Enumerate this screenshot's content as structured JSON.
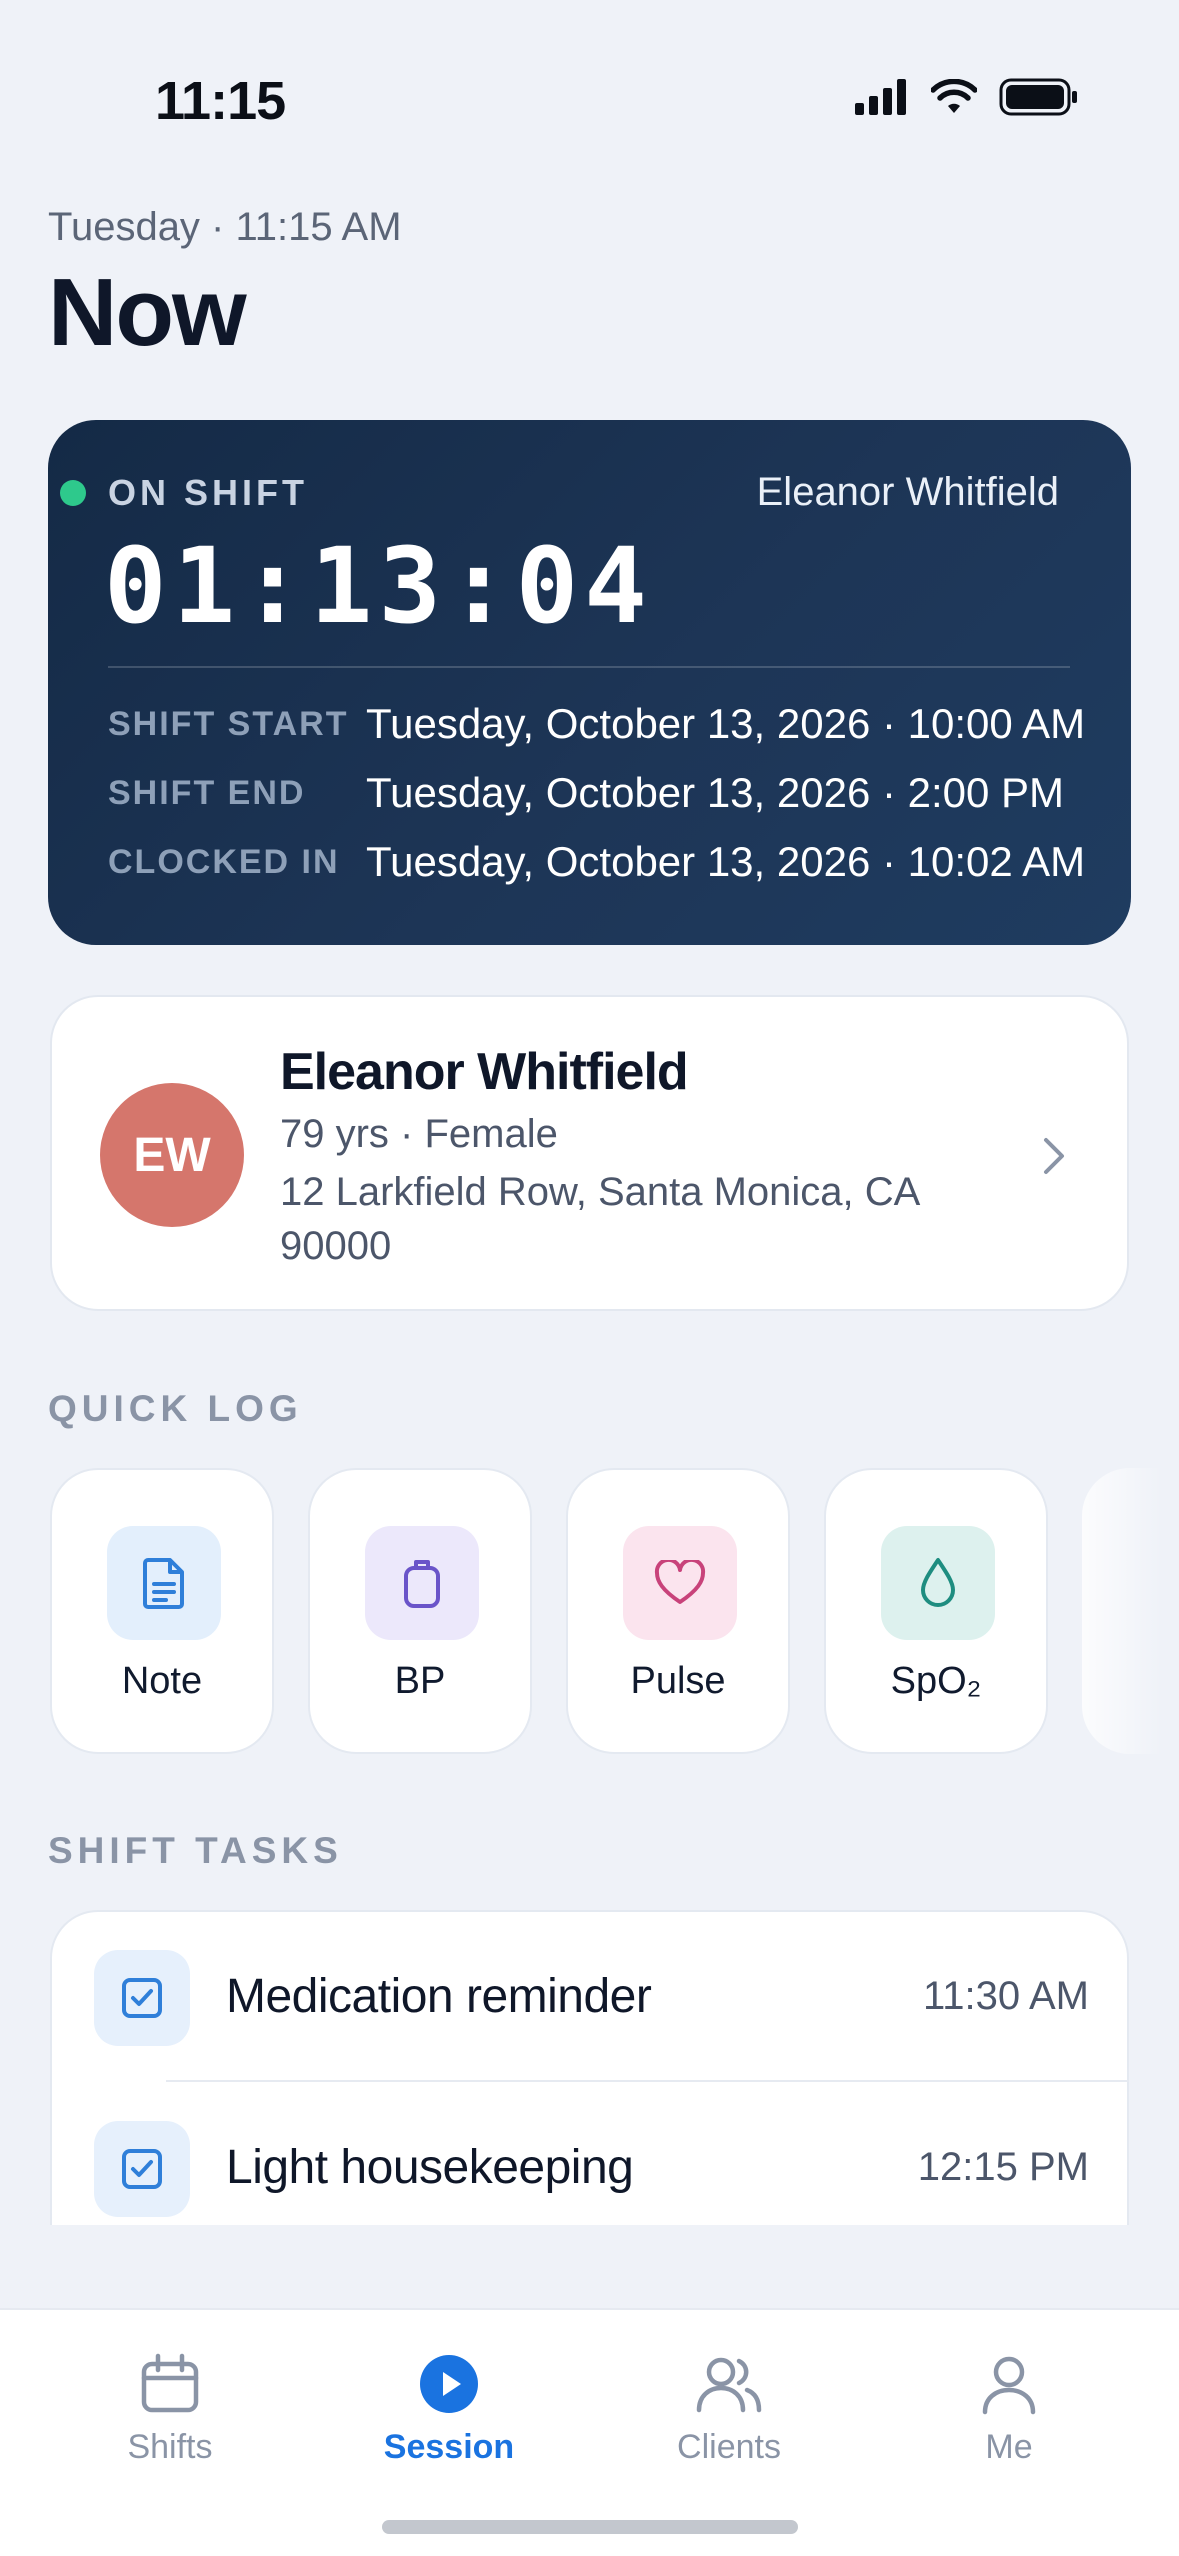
{
  "status_bar": {
    "time": "11:15"
  },
  "header": {
    "date_line": "Tuesday · 11:15 AM",
    "title": "Now"
  },
  "shift": {
    "status": "ON SHIFT",
    "client": "Eleanor Whitfield",
    "elapsed": "01:13:04",
    "rows": [
      {
        "label": "SHIFT START",
        "value": "Tuesday, October 13, 2026 · 10:00 AM"
      },
      {
        "label": "SHIFT END",
        "value": "Tuesday, October 13, 2026 · 2:00 PM"
      },
      {
        "label": "CLOCKED IN",
        "value": "Tuesday, October 13, 2026 · 10:02 AM"
      }
    ],
    "status_color": "#2ec98c"
  },
  "client": {
    "initials": "EW",
    "name": "Eleanor Whitfield",
    "meta": "79 yrs · Female",
    "address": "12 Larkfield Row, Santa Monica, CA 90000",
    "avatar_color": "#d5766c"
  },
  "quick_log": {
    "label": "QUICK LOG",
    "items": [
      {
        "label": "Note",
        "icon": "note-icon",
        "bg": "#e3effc",
        "color": "#2f7fd9"
      },
      {
        "label": "BP",
        "icon": "bp-cuff-icon",
        "bg": "#ece8fb",
        "color": "#6a54c9"
      },
      {
        "label": "Pulse",
        "icon": "heart-icon",
        "bg": "#fbe4ee",
        "color": "#c8427a"
      },
      {
        "label": "SpO₂",
        "icon": "droplet-icon",
        "bg": "#ddf1ee",
        "color": "#1e8d80"
      }
    ]
  },
  "tasks": {
    "label": "SHIFT TASKS",
    "items": [
      {
        "title": "Medication reminder",
        "time": "11:30 AM"
      },
      {
        "title": "Light housekeeping",
        "time": "12:15 PM"
      }
    ]
  },
  "tabbar": {
    "tabs": [
      {
        "label": "Shifts",
        "icon": "calendar-icon",
        "active": false
      },
      {
        "label": "Session",
        "icon": "play-icon",
        "active": true
      },
      {
        "label": "Clients",
        "icon": "people-icon",
        "active": false
      },
      {
        "label": "Me",
        "icon": "person-icon",
        "active": false
      }
    ],
    "active_color": "#1a73e0"
  }
}
